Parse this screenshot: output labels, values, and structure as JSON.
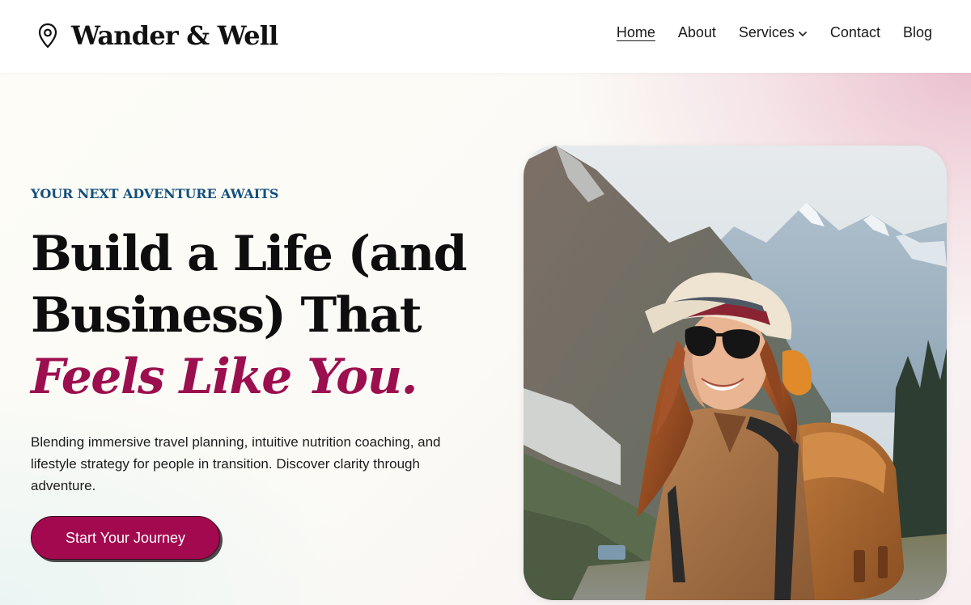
{
  "brand": {
    "name": "Wander & Well",
    "icon": "location-pin-icon"
  },
  "nav": {
    "items": [
      {
        "label": "Home",
        "active": true
      },
      {
        "label": "About"
      },
      {
        "label": "Services",
        "icon": "chevron-down-icon"
      },
      {
        "label": "Contact"
      },
      {
        "label": "Blog"
      }
    ]
  },
  "hero": {
    "eyebrow": "YOUR NEXT ADVENTURE AWAITS",
    "headline_line1": "Build a Life (and",
    "headline_line2": "Business) That",
    "headline_accent": "Feels Like You.",
    "description": "Blending immersive travel planning, intuitive nutrition coaching, and lifestyle strategy for people in transition. Discover clarity through adventure.",
    "cta_label": "Start Your Journey",
    "photo_alt": "Smiling woman hiker with hat, sunglasses and backpack in a mountain valley"
  },
  "colors": {
    "accent": "#a3094f",
    "eyebrow": "#14507e",
    "headline": "#0e0e0e"
  }
}
